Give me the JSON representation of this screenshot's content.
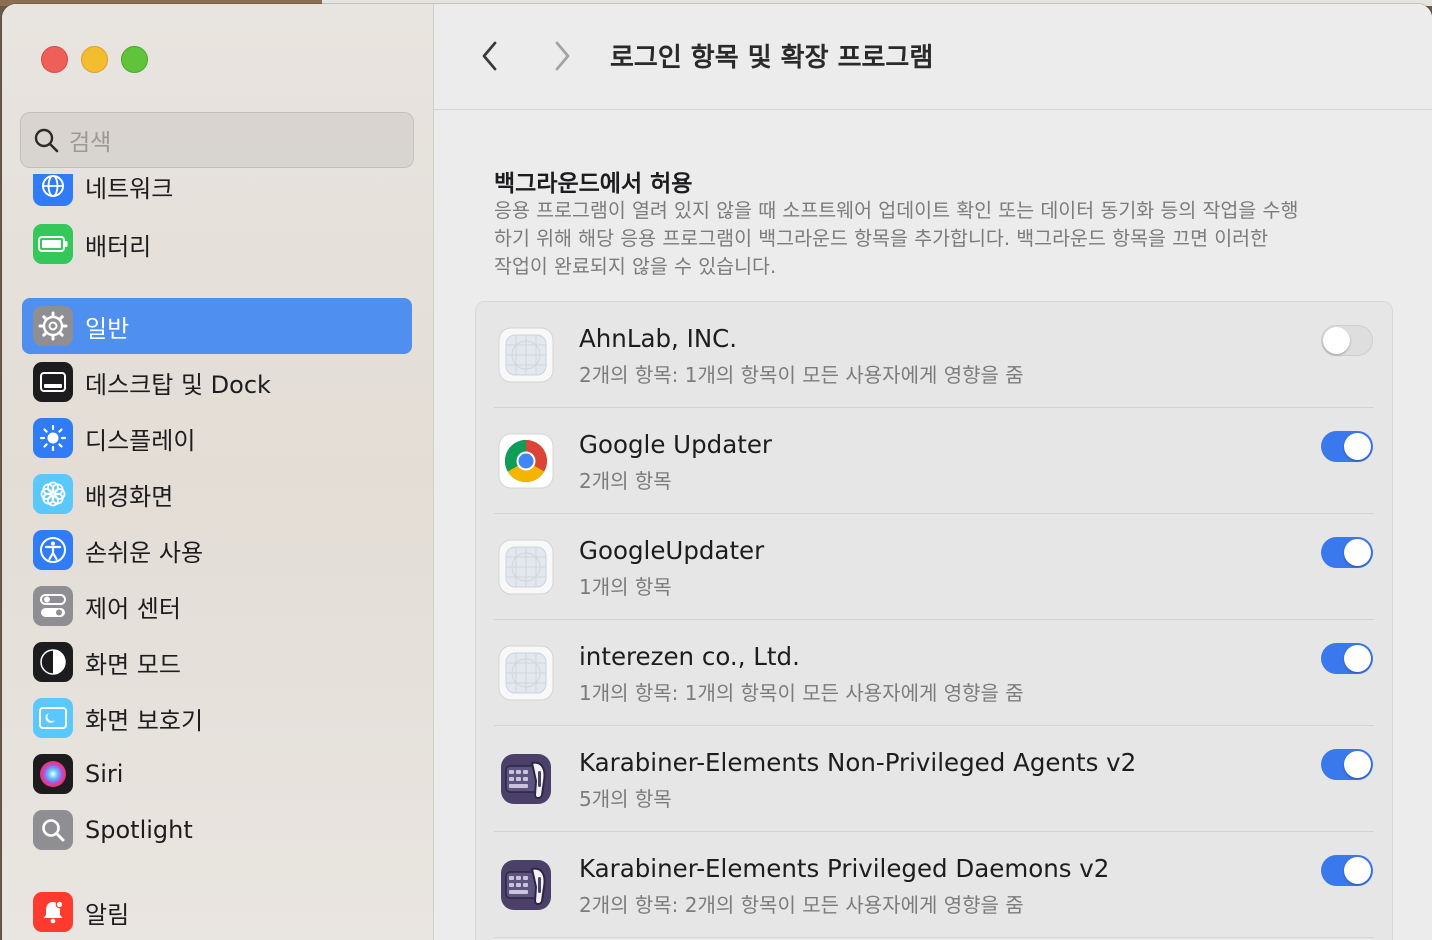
{
  "window": {
    "title": "로그인 항목 및 확장 프로그램",
    "search": {
      "placeholder": "검색"
    }
  },
  "sidebar": {
    "items": [
      {
        "label": "네트워크",
        "icon": "globe-icon",
        "color": "#2f7cf6"
      },
      {
        "label": "배터리",
        "icon": "battery-icon",
        "color": "#34c759"
      },
      {
        "label": "일반",
        "icon": "gear-icon",
        "color": "#8e8e93",
        "selected": true
      },
      {
        "label": "데스크탑 및 Dock",
        "icon": "dock-icon",
        "color": "#1c1c1e"
      },
      {
        "label": "디스플레이",
        "icon": "sun-icon",
        "color": "#2f7cf6"
      },
      {
        "label": "배경화면",
        "icon": "flower-icon",
        "color": "#5ac8fa"
      },
      {
        "label": "손쉬운 사용",
        "icon": "accessibility-icon",
        "color": "#2f7cf6"
      },
      {
        "label": "제어 센터",
        "icon": "switches-icon",
        "color": "#8e8e93"
      },
      {
        "label": "화면 모드",
        "icon": "appearance-icon",
        "color": "#1c1c1e"
      },
      {
        "label": "화면 보호기",
        "icon": "screensaver-icon",
        "color": "#5ac8fa"
      },
      {
        "label": "Siri",
        "icon": "siri-icon",
        "color": "#1c1c1e"
      },
      {
        "label": "Spotlight",
        "icon": "magnifier-icon",
        "color": "#8e8e93"
      },
      {
        "label": "알림",
        "icon": "bell-icon",
        "color": "#ff3b30"
      }
    ]
  },
  "main": {
    "section_title": "백그라운드에서 허용",
    "section_desc": "응용 프로그램이 열려 있지 않을 때 소프트웨어 업데이트 확인 또는 데이터 동기화 등의 작업을 수행\n하기 위해 해당 응용 프로그램이 백그라운드 항목을 추가합니다. 백그라운드 항목을 끄면 이러한\n작업이 완료되지 않을 수 있습니다.",
    "items": [
      {
        "name": "AhnLab, INC.",
        "detail": "2개의 항목: 1개의 항목이 모든 사용자에게 영향을 줌",
        "enabled": false,
        "icon": "generic-app-icon"
      },
      {
        "name": "Google Updater",
        "detail": "2개의 항목",
        "enabled": true,
        "icon": "chrome-icon"
      },
      {
        "name": "GoogleUpdater",
        "detail": "1개의 항목",
        "enabled": true,
        "icon": "generic-app-icon"
      },
      {
        "name": "interezen co., Ltd.",
        "detail": "1개의 항목: 1개의 항목이 모든 사용자에게 영향을 줌",
        "enabled": true,
        "icon": "generic-app-icon"
      },
      {
        "name": "Karabiner-Elements Non-Privileged Agents v2",
        "detail": "5개의 항목",
        "enabled": true,
        "icon": "karabiner-icon"
      },
      {
        "name": "Karabiner-Elements Privileged Daemons v2",
        "detail": "2개의 항목: 2개의 항목이 모든 사용자에게 영향을 줌",
        "enabled": true,
        "icon": "karabiner-icon"
      }
    ]
  },
  "colors": {
    "accent": "#3a78ed",
    "selection": "#4f8ff0"
  }
}
